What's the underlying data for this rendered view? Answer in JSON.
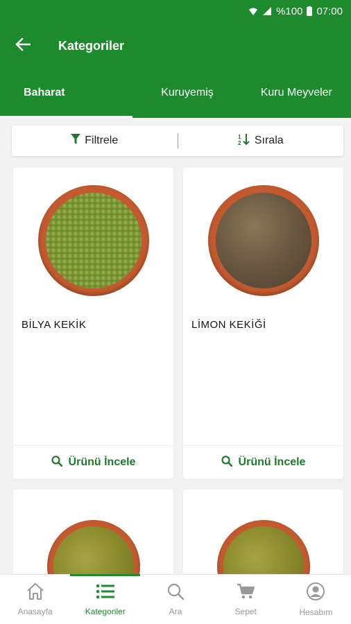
{
  "status_bar": {
    "battery": "%100",
    "time": "07:00"
  },
  "app_bar": {
    "title": "Kategoriler"
  },
  "tabs": [
    {
      "label": "Baharat",
      "active": true
    },
    {
      "label": "Kuruyemiş",
      "active": false
    },
    {
      "label": "Kuru Meyveler",
      "active": false
    }
  ],
  "toolbar": {
    "filter_label": "Filtrele",
    "sort_label": "Sırala"
  },
  "products": [
    {
      "name": "BİLYA KEKİK",
      "action_label": "Ürünü İncele",
      "spice_color": "#7f9a3a"
    },
    {
      "name": "LİMON KEKİĞİ",
      "action_label": "Ürünü İncele",
      "spice_color": "#6b5a43"
    },
    {
      "name": "",
      "action_label": "",
      "spice_color": "#8a8a2d"
    },
    {
      "name": "",
      "action_label": "",
      "spice_color": "#8a8a2d"
    }
  ],
  "bottom_nav": [
    {
      "label": "Anasayfa",
      "icon": "home-icon",
      "active": false
    },
    {
      "label": "Kategoriler",
      "icon": "list-icon",
      "active": true
    },
    {
      "label": "Ara",
      "icon": "search-icon",
      "active": false
    },
    {
      "label": "Sepet",
      "icon": "cart-icon",
      "active": false
    },
    {
      "label": "Hesabım",
      "icon": "account-icon",
      "active": false
    }
  ],
  "colors": {
    "primary": "#1e8a2e",
    "accent_text": "#1e7a2a",
    "bowl": "#c35a2f"
  }
}
